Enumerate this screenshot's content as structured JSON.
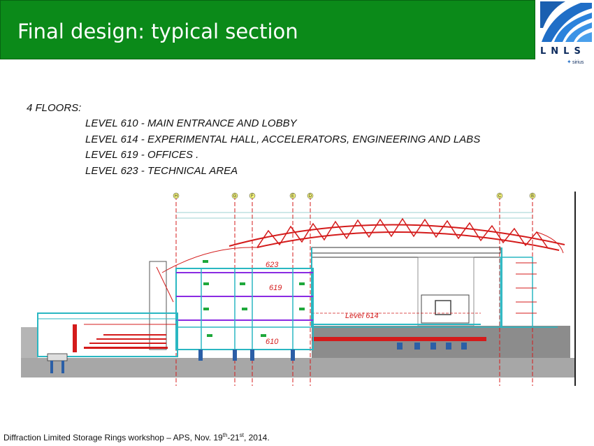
{
  "header": {
    "title": "Final design: typical section",
    "background": "#0b8a19"
  },
  "logo": {
    "icon": "lnls-logo-icon",
    "text": "LNLS",
    "subtext": "sirius"
  },
  "content": {
    "floors_label": "4 FLOORS:",
    "levels": [
      "LEVEL 610 - MAIN ENTRANCE AND LOBBY",
      "LEVEL 614 - EXPERIMENTAL HALL, ACCELERATORS, ENGINEERING AND LABS",
      "LEVEL 619 - OFFICES .",
      "LEVEL 623  - TECHNICAL AREA"
    ]
  },
  "drawing": {
    "grid_labels": [
      "H",
      "G",
      "F",
      "E",
      "D",
      "C",
      "B"
    ],
    "level_labels": [
      "623",
      "619",
      "610",
      "Level 614"
    ]
  },
  "footer": {
    "text_start": "Diffraction Limited Storage Rings workshop – APS, Nov. 19",
    "sup1": "th",
    "text_mid": "-21",
    "sup2": "st",
    "text_end": ", 2014."
  }
}
